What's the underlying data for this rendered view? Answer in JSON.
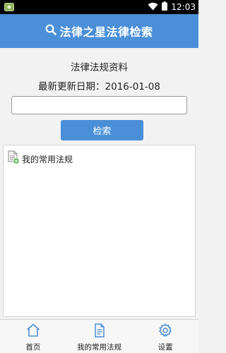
{
  "status_bar": {
    "time": "12:03",
    "icons": [
      "notification-icon",
      "wifi-icon",
      "battery-icon"
    ]
  },
  "app_bar": {
    "icon": "search-icon",
    "title": "法律之星法律检索"
  },
  "database": {
    "title": "法律法规资料",
    "last_updated": "最新更新日期：2016-01-08"
  },
  "search": {
    "value": "",
    "placeholder": "",
    "button_label": "检索"
  },
  "favorites": {
    "items": [
      {
        "icon": "favorites-document-icon",
        "label": "我的常用法规"
      }
    ]
  },
  "bottom_nav": {
    "items": [
      {
        "icon": "home-icon",
        "label": "首页"
      },
      {
        "icon": "document-icon",
        "label": "我的常用法规"
      },
      {
        "icon": "gear-icon",
        "label": "设置"
      }
    ]
  },
  "colors": {
    "accent": "#4a8fd8",
    "status_bar": "#000000",
    "background": "#f2f2f2"
  }
}
